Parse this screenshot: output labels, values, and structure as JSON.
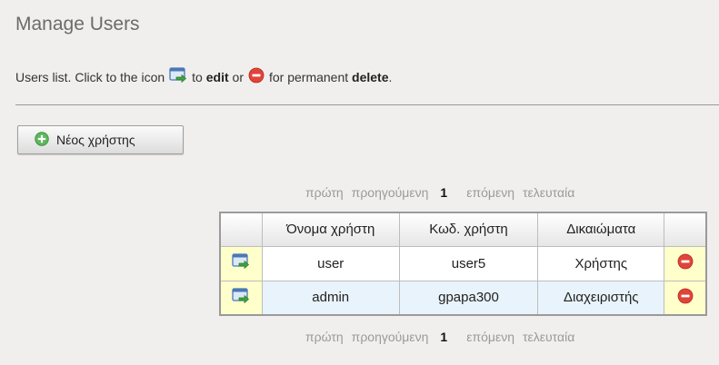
{
  "page": {
    "title": "Manage Users",
    "intro": {
      "part1": "Users list. Click to the icon",
      "part2": "to",
      "edit": "edit",
      "part3": "or",
      "part4": "for permanent",
      "delete": "delete",
      "period": "."
    }
  },
  "toolbar": {
    "new_user_label": "Νέος χρήστης",
    "new_user_icon": "plus-circle-icon"
  },
  "pager": {
    "first": "πρώτη",
    "previous": "προηγούμενη",
    "current": "1",
    "next": "επόμενη",
    "last": "τελευταία"
  },
  "table": {
    "columns": [
      "",
      "Όνομα χρήστη",
      "Κωδ. χρήστη",
      "Δικαιώματα",
      ""
    ],
    "rows": [
      {
        "username": "user",
        "password": "user5",
        "role": "Χρήστης"
      },
      {
        "username": "admin",
        "password": "gpapa300",
        "role": "Διαχειριστής"
      }
    ]
  },
  "colors": {
    "background": "#f1efee",
    "action_cell": "#ffffcc",
    "alt_row": "#e9f3fb",
    "delete_icon": "#e0443a",
    "add_icon": "#4caf50",
    "pager_muted": "#9a9a9a"
  }
}
